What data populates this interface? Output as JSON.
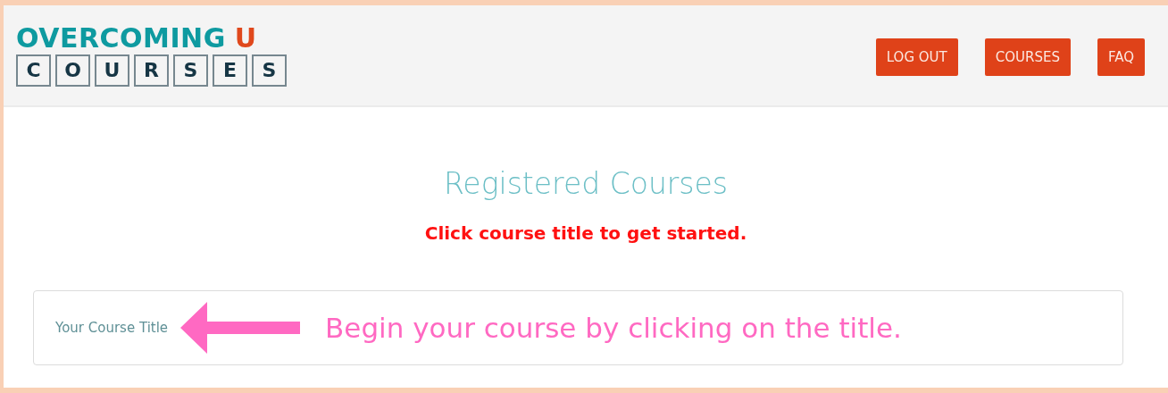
{
  "logo": {
    "word": "OVERCOMING",
    "accent": "U",
    "letters": [
      "C",
      "O",
      "U",
      "R",
      "S",
      "E",
      "S"
    ]
  },
  "nav": [
    {
      "label": "LOG OUT"
    },
    {
      "label": "COURSES"
    },
    {
      "label": "FAQ"
    }
  ],
  "heading": "Registered Courses",
  "instruction": "Click course title to get started.",
  "courses": [
    {
      "title": "Your Course Title",
      "hint": "Begin your course by clicking on the title."
    }
  ]
}
